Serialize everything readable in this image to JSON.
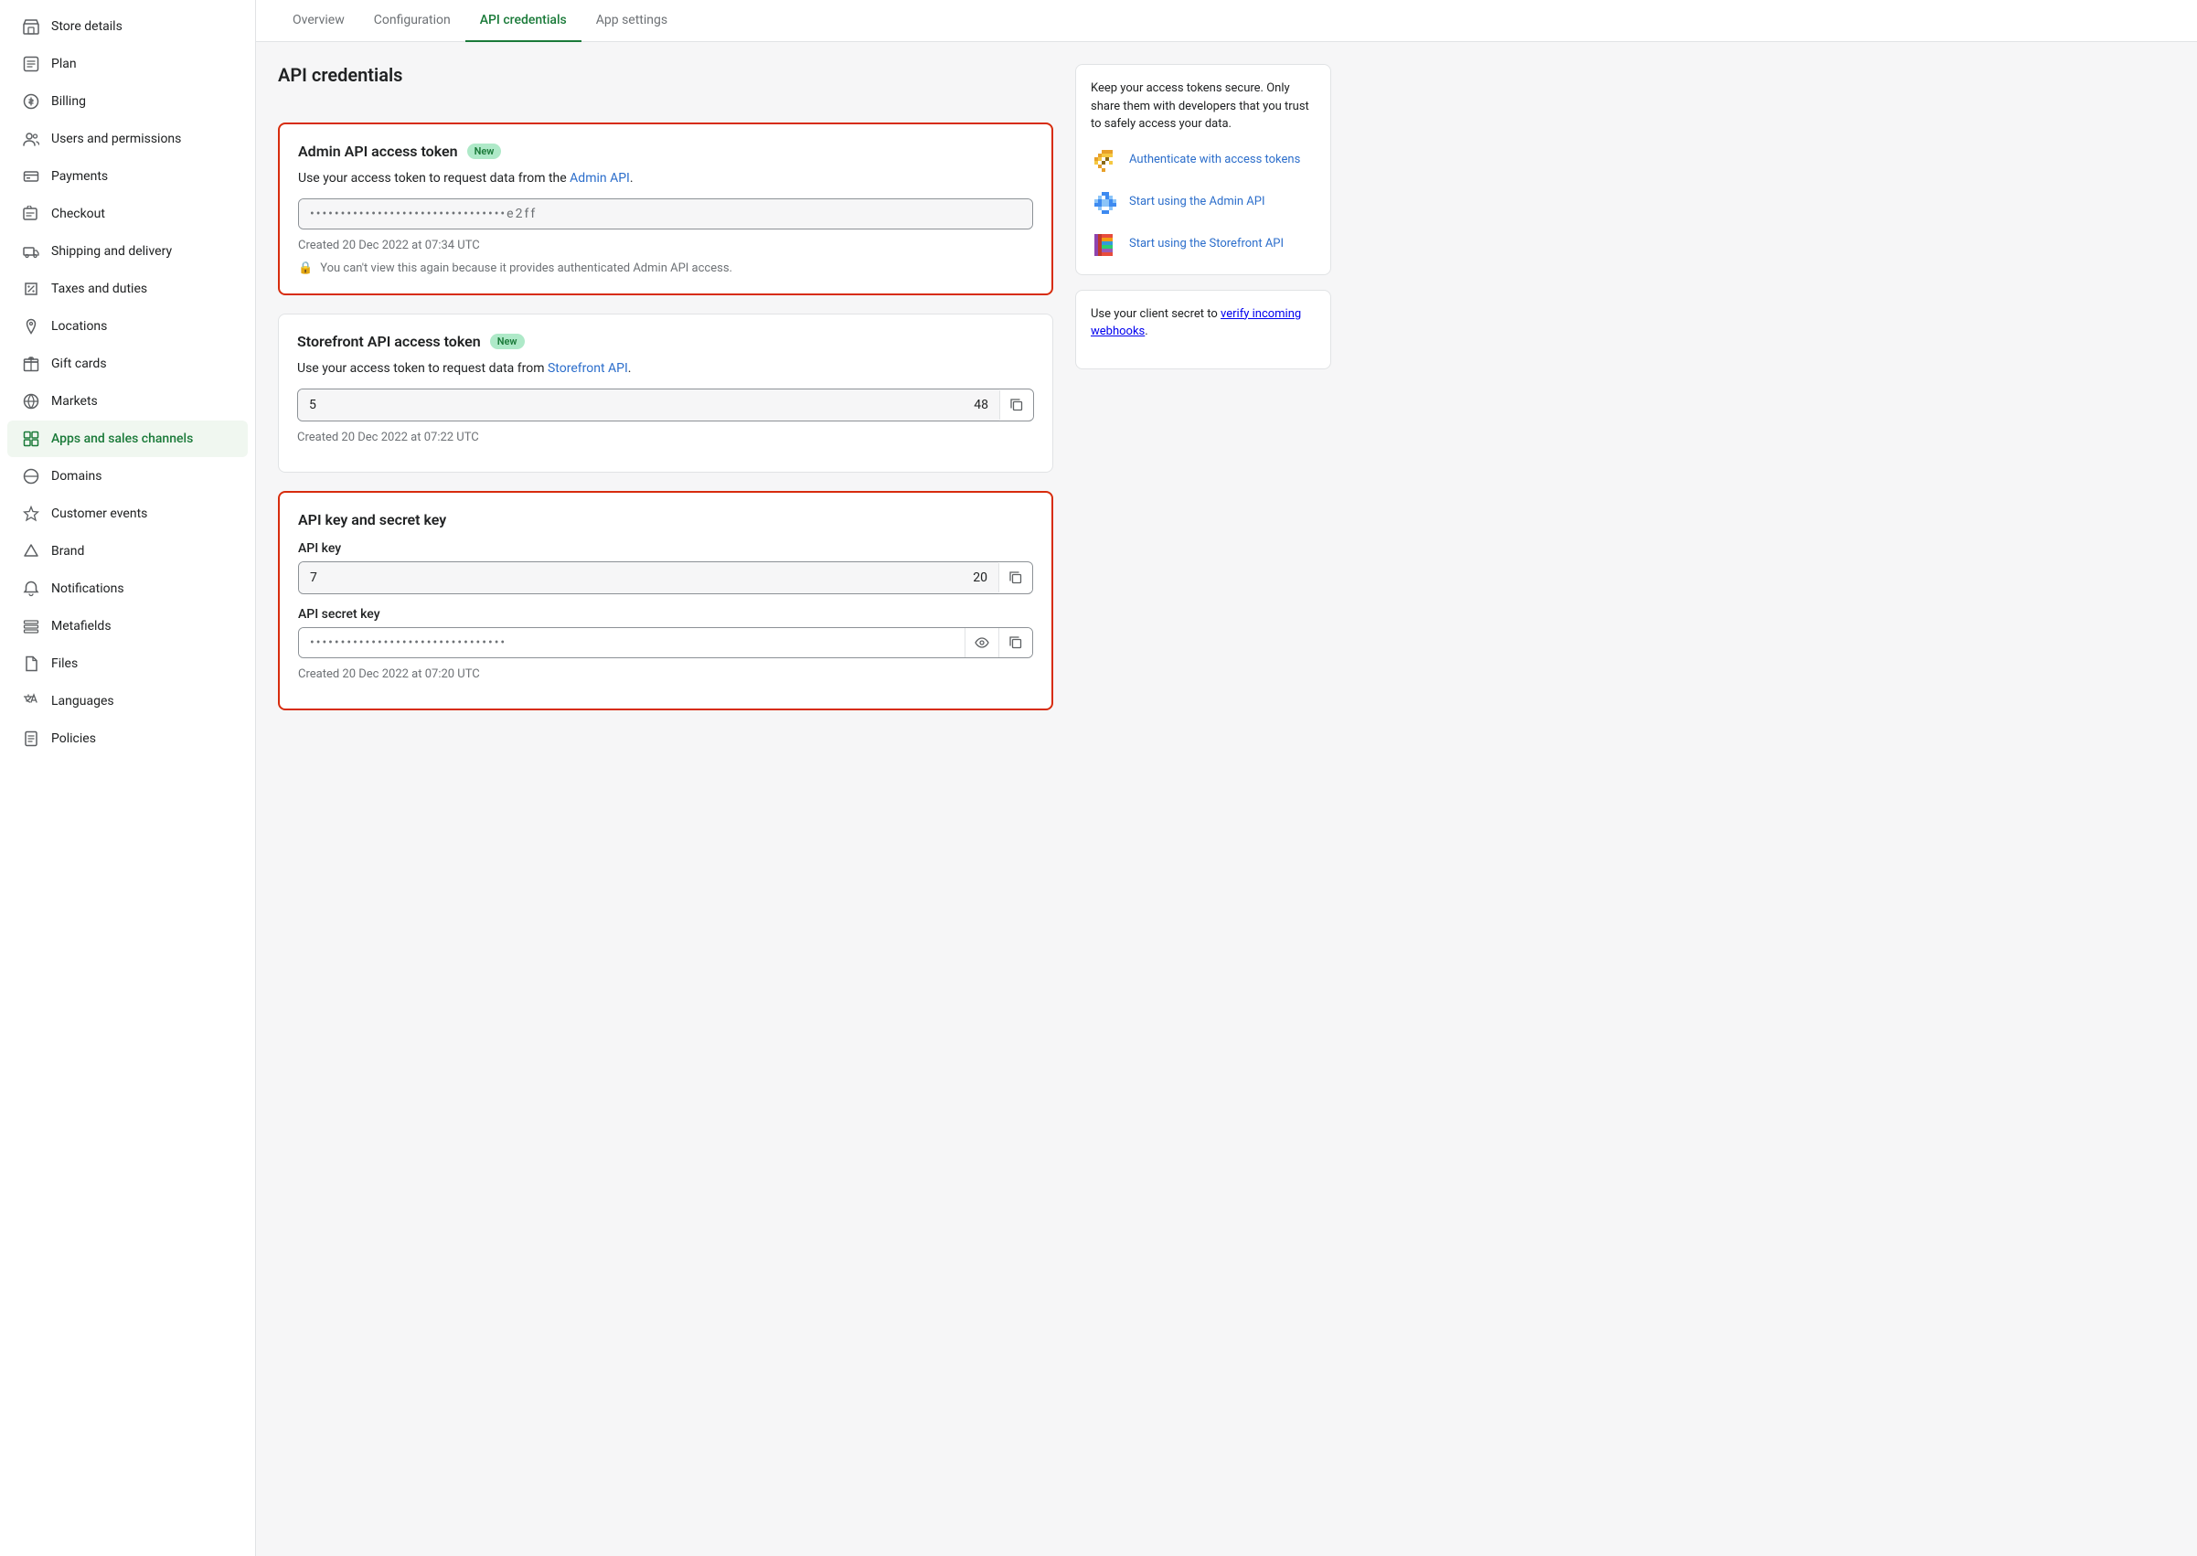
{
  "sidebar": {
    "items": [
      {
        "id": "store-details",
        "label": "Store details",
        "icon": "store"
      },
      {
        "id": "plan",
        "label": "Plan",
        "icon": "plan"
      },
      {
        "id": "billing",
        "label": "Billing",
        "icon": "billing"
      },
      {
        "id": "users-permissions",
        "label": "Users and permissions",
        "icon": "users"
      },
      {
        "id": "payments",
        "label": "Payments",
        "icon": "payments"
      },
      {
        "id": "checkout",
        "label": "Checkout",
        "icon": "checkout"
      },
      {
        "id": "shipping-delivery",
        "label": "Shipping and delivery",
        "icon": "shipping"
      },
      {
        "id": "taxes-duties",
        "label": "Taxes and duties",
        "icon": "taxes"
      },
      {
        "id": "locations",
        "label": "Locations",
        "icon": "locations"
      },
      {
        "id": "gift-cards",
        "label": "Gift cards",
        "icon": "gift"
      },
      {
        "id": "markets",
        "label": "Markets",
        "icon": "markets"
      },
      {
        "id": "apps-sales-channels",
        "label": "Apps and sales channels",
        "icon": "apps",
        "active": true
      },
      {
        "id": "domains",
        "label": "Domains",
        "icon": "domains"
      },
      {
        "id": "customer-events",
        "label": "Customer events",
        "icon": "customer-events"
      },
      {
        "id": "brand",
        "label": "Brand",
        "icon": "brand"
      },
      {
        "id": "notifications",
        "label": "Notifications",
        "icon": "notifications"
      },
      {
        "id": "metafields",
        "label": "Metafields",
        "icon": "metafields"
      },
      {
        "id": "files",
        "label": "Files",
        "icon": "files"
      },
      {
        "id": "languages",
        "label": "Languages",
        "icon": "languages"
      },
      {
        "id": "policies",
        "label": "Policies",
        "icon": "policies"
      }
    ]
  },
  "tabs": [
    {
      "id": "overview",
      "label": "Overview",
      "active": false
    },
    {
      "id": "configuration",
      "label": "Configuration",
      "active": false
    },
    {
      "id": "api-credentials",
      "label": "API credentials",
      "active": true
    },
    {
      "id": "app-settings",
      "label": "App settings",
      "active": false
    }
  ],
  "page_title": "API credentials",
  "sections": {
    "admin_token": {
      "title": "Admin API access token",
      "badge": "New",
      "description_prefix": "Use your access token to request data from the ",
      "description_link": "Admin API",
      "description_suffix": ".",
      "token_masked": "••••••••••••••••••••••••••••••••e2ff",
      "created_text": "Created 20 Dec 2022 at 07:34 UTC",
      "warning": "You can't view this again because it provides authenticated Admin API access.",
      "red_border": true
    },
    "storefront_token": {
      "title": "Storefront API access token",
      "badge": "New",
      "description_prefix": "Use your access token to request data from ",
      "description_link": "Storefront API",
      "description_suffix": ".",
      "token_start": "5",
      "token_end": "48",
      "created_text": "Created 20 Dec 2022 at 07:22 UTC",
      "red_border": false
    },
    "api_key": {
      "title": "API key and secret key",
      "api_key_label": "API key",
      "api_key_start": "7",
      "api_key_end": "20",
      "secret_key_label": "API secret key",
      "secret_masked": "••••••••••••••••••••••••••••••••",
      "created_text": "Created 20 Dec 2022 at 07:20 UTC",
      "red_border": true
    }
  },
  "right_panel": {
    "security_note": "Keep your access tokens secure. Only share them with developers that you trust to safely access your data.",
    "links": [
      {
        "id": "auth-tokens",
        "label": "Authenticate with access tokens",
        "icon": "token-icon"
      },
      {
        "id": "admin-api",
        "label": "Start using the Admin API",
        "icon": "admin-api-icon"
      },
      {
        "id": "storefront-api",
        "label": "Start using the Storefront API",
        "icon": "storefront-api-icon"
      }
    ],
    "webhooks_note_prefix": "Use your client secret to ",
    "webhooks_link": "verify incoming webhooks",
    "webhooks_note_suffix": "."
  }
}
